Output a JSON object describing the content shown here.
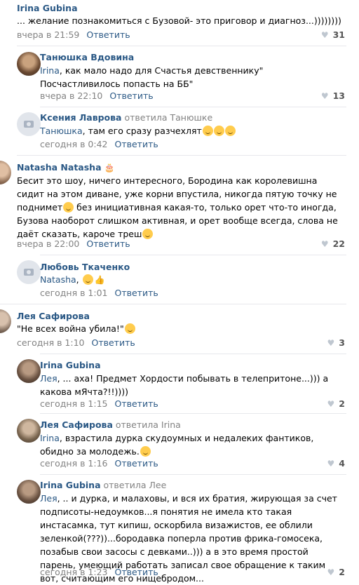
{
  "colors": {
    "link": "#2a5885",
    "muted": "#828282",
    "divider": "#e7e8ec"
  },
  "comments": [
    {
      "author": "Irina Gubina",
      "replied": "",
      "text": "... желание познакомиться с Бузовой- это приговор и диагноз...))))))))",
      "time": "вчера в 21:59",
      "reply": "Ответить",
      "likes": "31"
    },
    {
      "author": "Танюшка Вдовина",
      "replied": "",
      "mention": "Irina",
      "text": ", как мало надо для Счастья девственнику\" Посчастливилось попасть на ББ\"",
      "time": "вчера в 22:10",
      "reply": "Ответить",
      "likes": "13"
    },
    {
      "author": "Ксения Лаврова",
      "replied": "ответила Танюшке",
      "mention": "Танюшка",
      "text": ", там его сразу разчехлят",
      "time": "сегодня в 0:42",
      "reply": "Ответить",
      "likes": ""
    },
    {
      "author": "Natasha Natasha",
      "replied": "",
      "text": "Бесит это шоу, ничего интересного, Бородина как королевишна сидит на этом диване, уже корни впустила, никогда пятую точку не поднимет",
      "text2": " без инициативная какая-то, только орет что-то иногда, Бузова наоборот слишком активная, и орет вообще всегда, слова не даёт сказать, кароче треш",
      "time": "вчера в 22:00",
      "reply": "Ответить",
      "likes": "22"
    },
    {
      "author": "Любовь Ткаченко",
      "replied": "",
      "mention": "Natasha",
      "text": ",",
      "time": "сегодня в 1:01",
      "reply": "Ответить",
      "likes": ""
    },
    {
      "author": "Лея Сафирова",
      "replied": "",
      "text": "\"Не всех война убила!\"",
      "time": "сегодня в 1:10",
      "reply": "Ответить",
      "likes": "3"
    },
    {
      "author": "Irina Gubina",
      "replied": "",
      "mention": "Лея",
      "text": ", ... аха! Предмет Хордости побывать в телепритоне...))) а какова мЯчта?!!))))",
      "time": "сегодня в 1:15",
      "reply": "Ответить",
      "likes": "2"
    },
    {
      "author": "Лея Сафирова",
      "replied": "ответила Irina",
      "mention": "Irina",
      "text": ", взрастила дурка скудоумных и недалеких фантиков, обидно за молодежь.",
      "time": "сегодня в 1:16",
      "reply": "Ответить",
      "likes": "4"
    },
    {
      "author": "Irina Gubina",
      "replied": "ответила Лее",
      "mention": "Лея",
      "text": ", .. и дурка, и малаховы, и вся их братия, жирующая за счет подписоты-недоумков...я понятия не имела кто такая инстасамка, тут кипиш, оскорбила визажистов, ее облили зеленкой(???))...бородавка поперла против фрика-гомосека, позабыв свои засосы с девками..))) а в это время простой парень, умеющий работать записал свое обращение к таким вот, считающим его нищебродом...",
      "time": "сегодня в 1:23",
      "reply": "Ответить",
      "likes": "2"
    }
  ]
}
